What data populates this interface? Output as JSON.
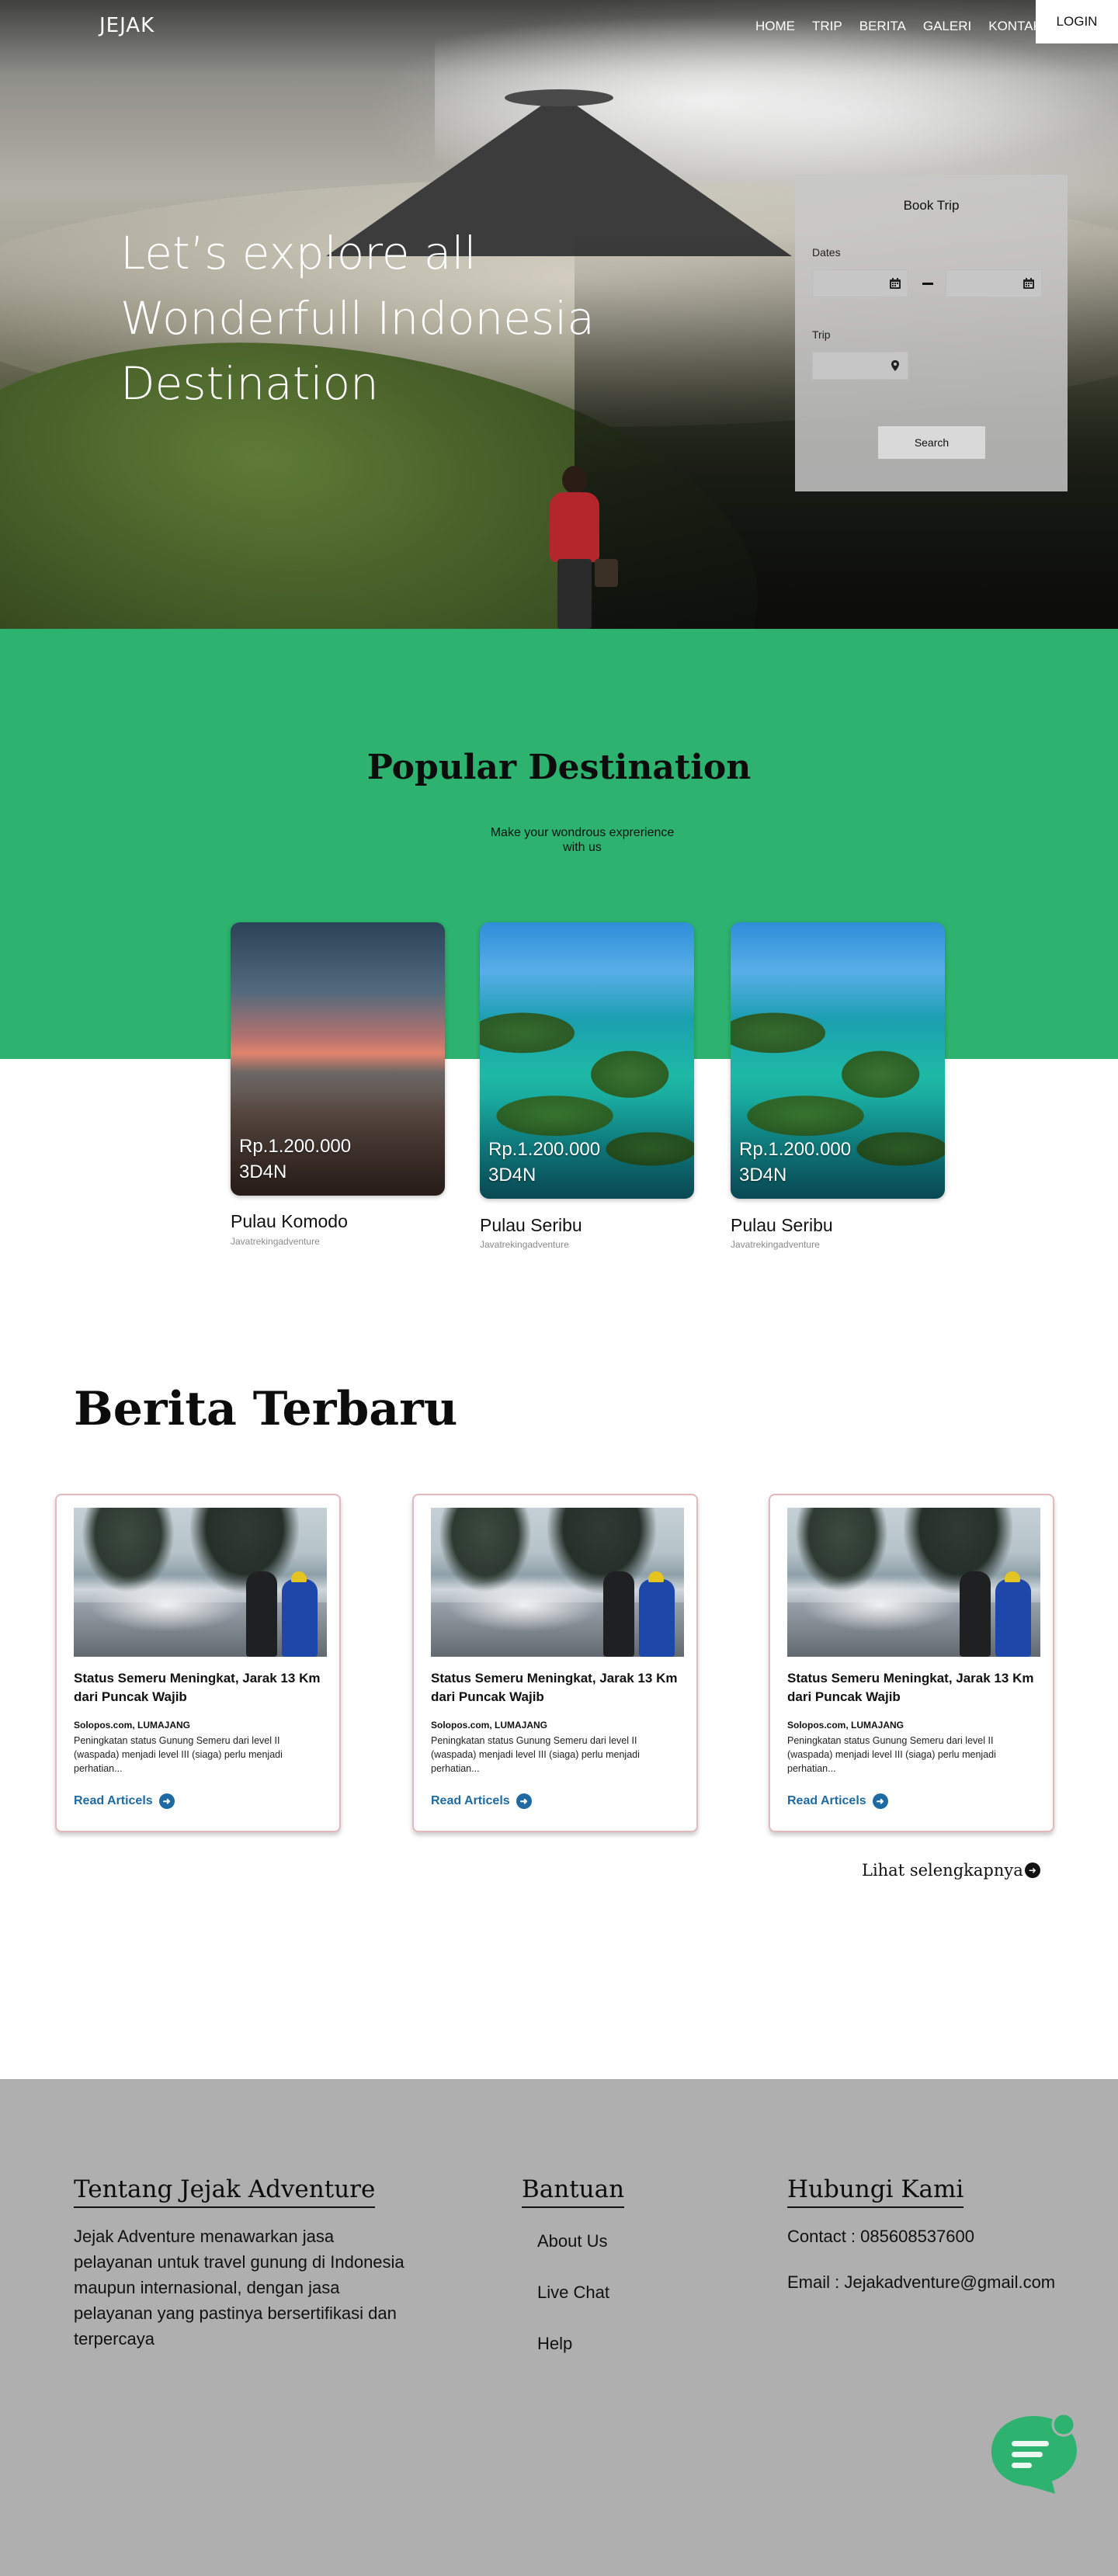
{
  "nav": {
    "brand": "JEJAK",
    "links": [
      "HOME",
      "TRIP",
      "BERITA",
      "GALERI",
      "KONTAK"
    ],
    "login": "LOGIN"
  },
  "hero": {
    "title": "Let’s explore all Wonderfull Indonesia Destination"
  },
  "booking": {
    "title": "Book Trip",
    "dates_label": "Dates",
    "trip_label": "Trip",
    "search_label": "Search",
    "icons": [
      "calendar-icon",
      "calendar-icon",
      "location-pin-icon"
    ]
  },
  "popular": {
    "title": "Popular Destination",
    "subtitle": "Make your wondrous exprerience with us",
    "cards": [
      {
        "price": "Rp.1.200.000",
        "duration": "3D4N",
        "name": "Pulau Komodo",
        "source": "Javatrekingadventure"
      },
      {
        "price": "Rp.1.200.000",
        "duration": "3D4N",
        "name": "Pulau Seribu",
        "source": "Javatrekingadventure"
      },
      {
        "price": "Rp.1.200.000",
        "duration": "3D4N",
        "name": "Pulau Seribu",
        "source": "Javatrekingadventure"
      }
    ]
  },
  "news": {
    "title": "Berita Terbaru",
    "articles": [
      {
        "headline": "Status Semeru Meningkat, Jarak 13 Km dari Puncak Wajib",
        "source": "Solopos.com, LUMAJANG",
        "body": "Peningkatan status Gunung Semeru dari level II (waspada) menjadi level III (siaga) perlu  menjadi perhatian...",
        "link": "Read Articels"
      },
      {
        "headline": "Status Semeru Meningkat, Jarak 13 Km dari Puncak Wajib",
        "source": "Solopos.com, LUMAJANG",
        "body": "Peningkatan status Gunung Semeru dari level II (waspada) menjadi level III (siaga) perlu  menjadi perhatian...",
        "link": "Read Articels"
      },
      {
        "headline": "Status Semeru Meningkat, Jarak 13 Km dari Puncak Wajib",
        "source": "Solopos.com, LUMAJANG",
        "body": "Peningkatan status Gunung Semeru dari level II (waspada) menjadi level III (siaga) perlu  menjadi perhatian...",
        "link": "Read Articels"
      }
    ],
    "more": "Lihat selengkapnya"
  },
  "footer": {
    "about_title": "Tentang Jejak Adventure",
    "about_text": "Jejak Adventure menawarkan jasa pelayanan untuk travel gunung di Indonesia maupun internasional, dengan jasa pelayanan yang pastinya bersertifikasi dan terpercaya",
    "help_title": "Bantuan",
    "help_links": [
      "About Us",
      "Live Chat",
      "Help"
    ],
    "contact_title": "Hubungi Kami",
    "contact_phone": "Contact : 085608537600",
    "contact_email": "Email : Jejakadventure@gmail.com"
  },
  "colors": {
    "green": "#2db36f",
    "footer_gray": "#afafaf",
    "link_blue": "#1f6aa3",
    "card_border": "#e4b8bd"
  }
}
